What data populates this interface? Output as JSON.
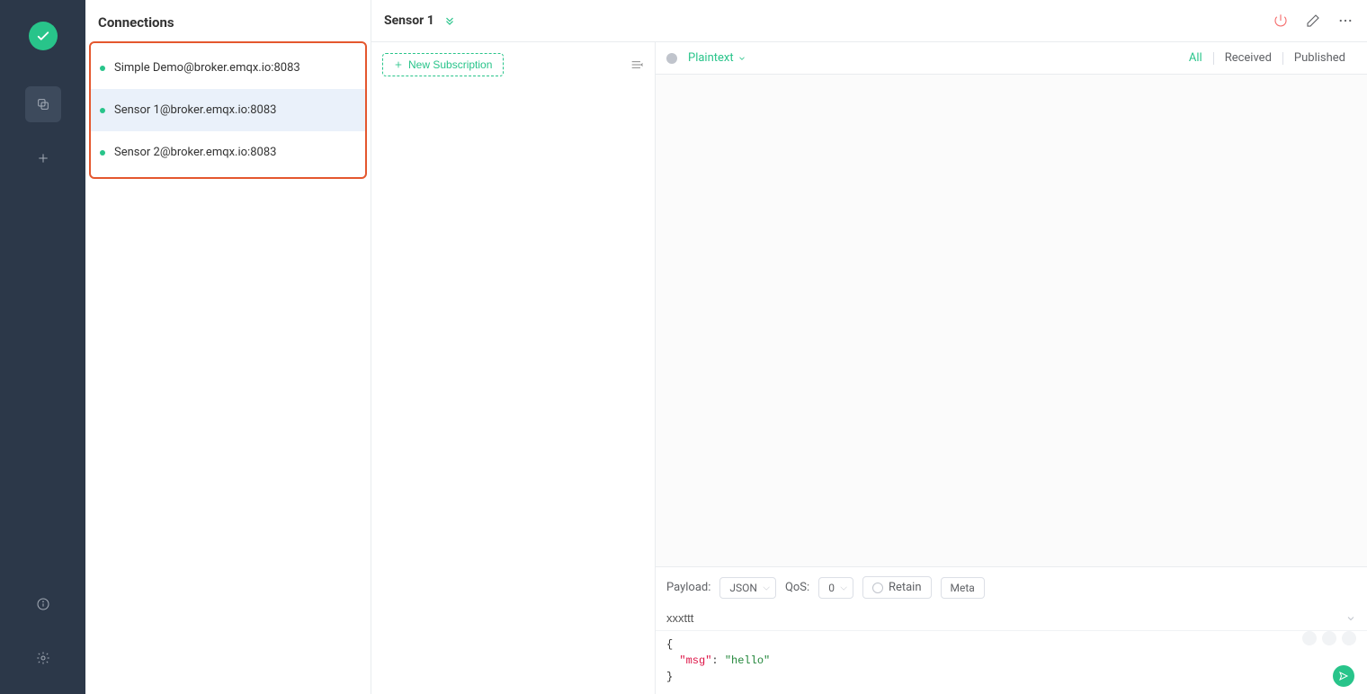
{
  "panel_title": "Connections",
  "connections": [
    {
      "label": "Simple Demo@broker.emqx.io:8083",
      "selected": false
    },
    {
      "label": "Sensor 1@broker.emqx.io:8083",
      "selected": true
    },
    {
      "label": "Sensor 2@broker.emqx.io:8083",
      "selected": false
    }
  ],
  "header": {
    "connection_title": "Sensor 1"
  },
  "subscriptions": {
    "new_button": "New Subscription"
  },
  "messages": {
    "format": "Plaintext",
    "filters": {
      "all": "All",
      "received": "Received",
      "published": "Published"
    }
  },
  "publish": {
    "payload_label": "Payload:",
    "payload_format": "JSON",
    "qos_label": "QoS:",
    "qos_value": "0",
    "retain_label": "Retain",
    "meta_label": "Meta",
    "topic_value": "xxxttt",
    "payload_body": {
      "open": "{",
      "key": "\"msg\"",
      "colon": ": ",
      "value": "\"hello\"",
      "close": "}"
    }
  },
  "colors": {
    "accent": "#28c48a",
    "highlight_border": "#e4572e",
    "danger": "#f56c6c"
  }
}
